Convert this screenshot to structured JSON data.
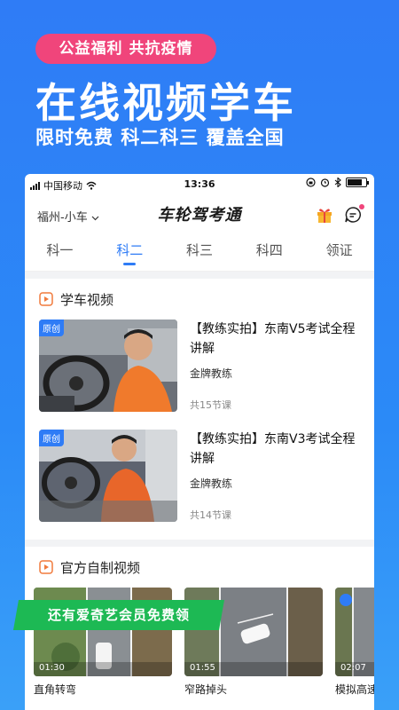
{
  "promo": {
    "badge": "公益福利  共抗疫情",
    "headline": "在线视频学车",
    "subheadline": "限时免费  科二科三  覆盖全国",
    "iqiyi_banner": "还有爱奇艺会员免费领"
  },
  "status_bar": {
    "carrier": "中国移动",
    "time": "13:36",
    "battery_level": 0.8
  },
  "app_bar": {
    "city": "福州-小车",
    "brand": "车轮驾考通"
  },
  "tabs": [
    {
      "label": "科一",
      "active": false
    },
    {
      "label": "科二",
      "active": true
    },
    {
      "label": "科三",
      "active": false
    },
    {
      "label": "科四",
      "active": false
    },
    {
      "label": "领证",
      "active": false
    }
  ],
  "section_courses": {
    "title": "学车视频",
    "items": [
      {
        "tag": "原创",
        "title": "【教练实拍】东南V5考试全程讲解",
        "teacher": "金牌教练",
        "count": "共15节课"
      },
      {
        "tag": "原创",
        "title": "【教练实拍】东南V3考试全程讲解",
        "teacher": "金牌教练",
        "count": "共14节课"
      }
    ]
  },
  "section_videos": {
    "title": "官方自制视频",
    "items": [
      {
        "duration": "01:30",
        "name": "直角转弯"
      },
      {
        "duration": "01:55",
        "name": "窄路掉头"
      },
      {
        "duration": "02:07",
        "name": "模拟高速"
      }
    ]
  },
  "colors": {
    "primary": "#2f7cf6",
    "pink": "#f0457b",
    "green": "#1db954"
  }
}
